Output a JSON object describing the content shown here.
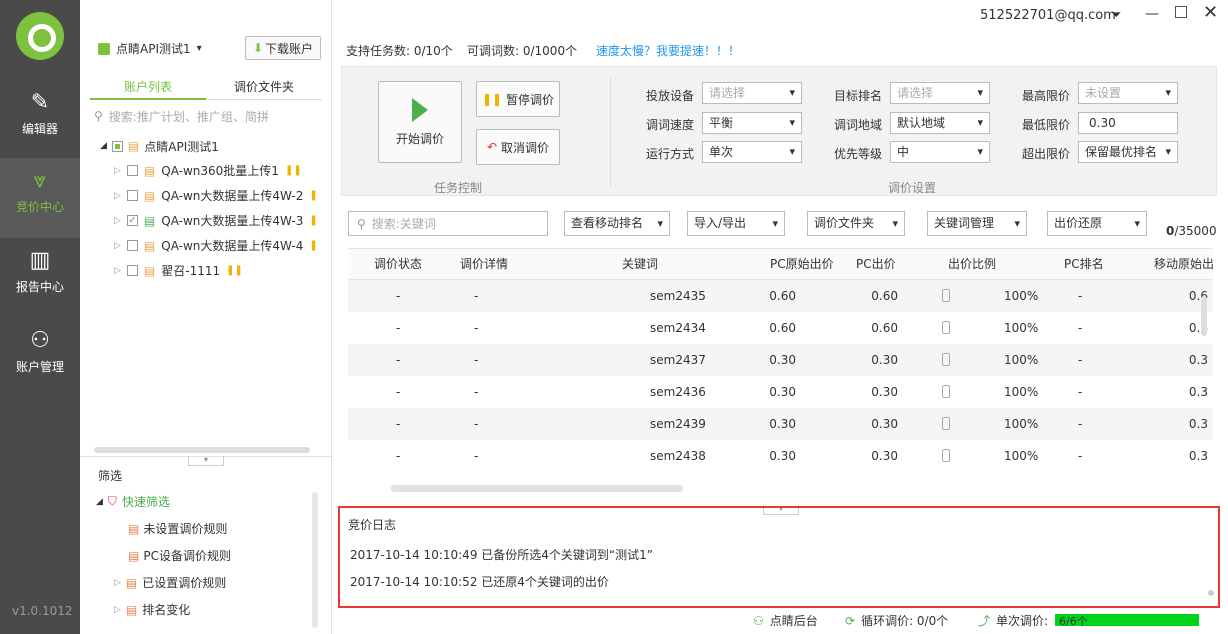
{
  "app": {
    "version": "v1.0.1012",
    "user_email": "512522701@qq.com"
  },
  "sidebar": {
    "items": [
      {
        "label": "编辑器",
        "icon": "edit-icon"
      },
      {
        "label": "竞价中心",
        "icon": "bid-icon",
        "active": true
      },
      {
        "label": "报告中心",
        "icon": "report-icon"
      },
      {
        "label": "账户管理",
        "icon": "user-icon"
      }
    ]
  },
  "account": {
    "name": "点睛API测试1",
    "download_label": "下载账户"
  },
  "left_tabs": [
    "账户列表",
    "调价文件夹"
  ],
  "left_search_placeholder": "搜索:推广计划、推广组、简拼",
  "tree": {
    "root": "点睛API测试1",
    "children": [
      "QA-wn360批量上传1",
      "QA-wn大数据量上传4W-2",
      "QA-wn大数据量上传4W-3",
      "QA-wn大数据量上传4W-4",
      "翟召-1111"
    ]
  },
  "filter": {
    "title": "筛选",
    "quick_label": "快速筛选",
    "items": [
      "未设置调价规则",
      "PC设备调价规则",
      "已设置调价规则",
      "排名变化"
    ]
  },
  "top_info": {
    "tasks": "支持任务数: 0/10个",
    "keywords": "可调词数: 0/1000个",
    "speed_link": "速度太慢？我要提速！！！"
  },
  "task_control": {
    "start_label": "开始调价",
    "pause_label": "暂停调价",
    "cancel_label": "取消调价",
    "section_label": "任务控制"
  },
  "settings": {
    "device_label": "投放设备",
    "device_value": "请选择",
    "speed_label": "调词速度",
    "speed_value": "平衡",
    "mode_label": "运行方式",
    "mode_value": "单次",
    "target_label": "目标排名",
    "target_value": "请选择",
    "region_label": "调词地域",
    "region_value": "默认地域",
    "priority_label": "优先等级",
    "priority_value": "中",
    "max_label": "最高限价",
    "max_value": "未设置",
    "min_label": "最低限价",
    "min_value": "0.30",
    "over_label": "超出限价",
    "over_value": "保留最优排名",
    "section_label": "调价设置"
  },
  "toolbar": {
    "search_placeholder": "搜索:关键词",
    "btns": [
      "查看移动排名",
      "导入/导出",
      "调价文件夹",
      "关键词管理",
      "出价还原"
    ],
    "count_bold": "0",
    "count_rest": "/35000"
  },
  "table": {
    "headers": [
      "调价状态",
      "调价详情",
      "关键词",
      "PC原始出价",
      "PC出价",
      "出价比例",
      "PC排名",
      "移动原始出"
    ],
    "rows": [
      [
        "-",
        "-",
        "sem2435",
        "0.60",
        "0.60",
        "100%",
        "-",
        "0.6"
      ],
      [
        "-",
        "-",
        "sem2434",
        "0.60",
        "0.60",
        "100%",
        "-",
        "0.6"
      ],
      [
        "-",
        "-",
        "sem2437",
        "0.30",
        "0.30",
        "100%",
        "-",
        "0.3"
      ],
      [
        "-",
        "-",
        "sem2436",
        "0.30",
        "0.30",
        "100%",
        "-",
        "0.3"
      ],
      [
        "-",
        "-",
        "sem2439",
        "0.30",
        "0.30",
        "100%",
        "-",
        "0.3"
      ],
      [
        "-",
        "-",
        "sem2438",
        "0.30",
        "0.30",
        "100%",
        "-",
        "0.3"
      ]
    ]
  },
  "log": {
    "title": "竞价日志",
    "entries": [
      "2017-10-14 10:10:49 已备份所选4个关键词到“测试1”",
      "2017-10-14 10:10:52 已还原4个关键词的出价"
    ]
  },
  "status": {
    "backend": "点睛后台",
    "loop": "循环调价: 0/0个",
    "single_label": "单次调价:",
    "single_value": "6/6个",
    "single_progress": 1.0
  },
  "colors": {
    "accent": "#7cc23e",
    "sidebar": "#4a4a4a",
    "log_border": "#e53935"
  }
}
